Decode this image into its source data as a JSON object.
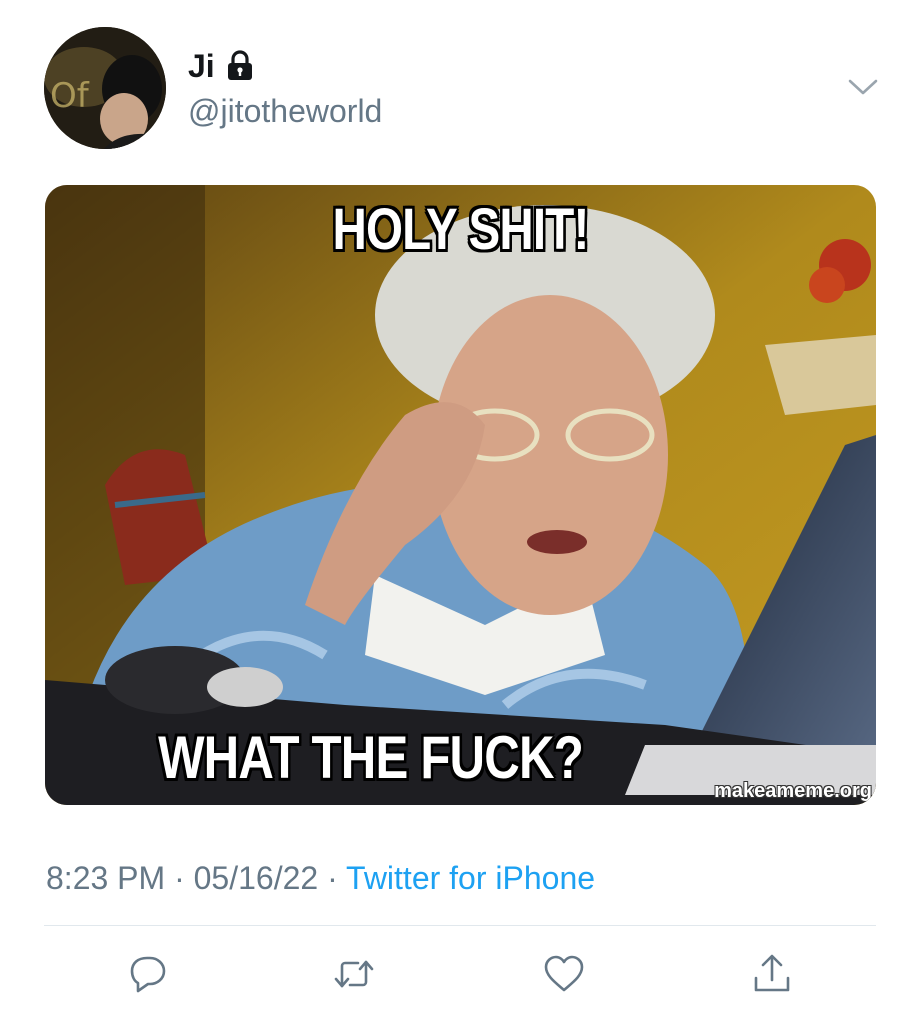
{
  "tweet": {
    "display_name": "Ji",
    "handle": "@jitotheworld",
    "protected_icon": "lock-icon",
    "menu_icon": "chevron-down-icon",
    "media": {
      "top_caption": "HOLY SHIT!",
      "bottom_caption": "WHAT THE FUCK?",
      "watermark": "makeameme.org"
    },
    "time": "8:23 PM",
    "date": "05/16/22",
    "separator": "·",
    "source": "Twitter for iPhone"
  },
  "actions": {
    "reply_icon": "reply-icon",
    "retweet_icon": "retweet-icon",
    "like_icon": "heart-icon",
    "share_icon": "share-icon"
  },
  "colors": {
    "link": "#1da1f2",
    "secondary_text": "#657786",
    "icon": "#657786"
  }
}
